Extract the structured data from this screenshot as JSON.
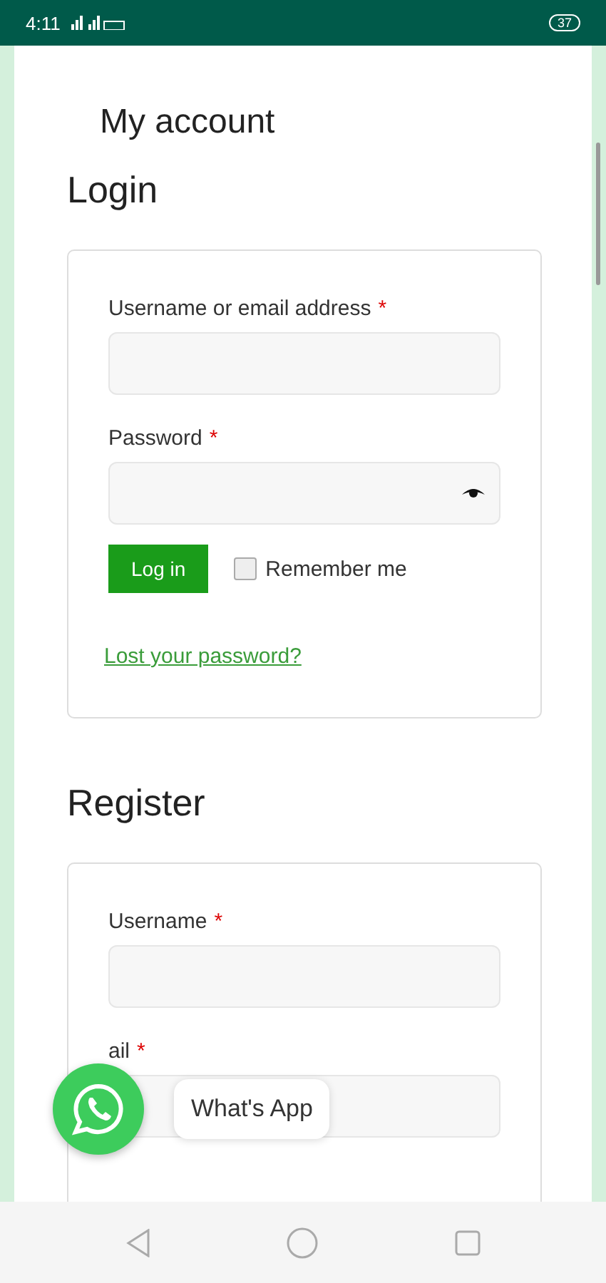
{
  "status_bar": {
    "time": "4:11",
    "battery": "37"
  },
  "page_title": "My account",
  "login": {
    "heading": "Login",
    "fields": [
      {
        "label": "Username or email address",
        "required_mark": "*",
        "kind": "text"
      },
      {
        "label": "Password",
        "required_mark": "*",
        "kind": "password"
      }
    ],
    "button": "Log in",
    "remember": {
      "label": "Remember me",
      "checked": false
    },
    "lost_link": "Lost your password?"
  },
  "register": {
    "heading": "Register",
    "fields": [
      {
        "label": "Username",
        "required_mark": "*",
        "kind": "text"
      },
      {
        "label": "ail",
        "required_mark": "*",
        "kind": "text"
      }
    ]
  },
  "chat_button": {
    "label": "What's App"
  }
}
